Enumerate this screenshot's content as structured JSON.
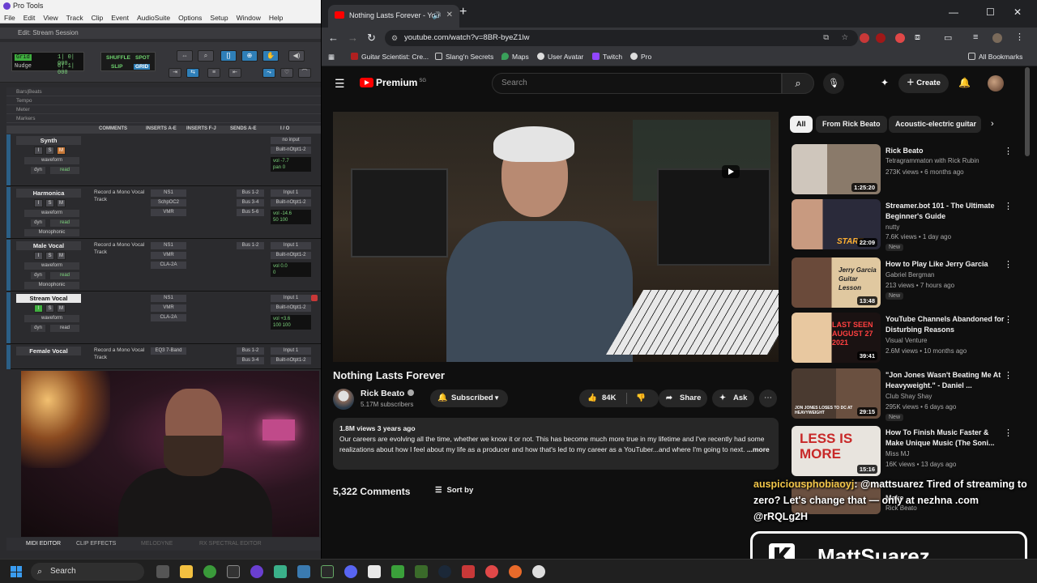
{
  "protools": {
    "app_title": "Pro Tools",
    "menu": [
      "File",
      "Edit",
      "View",
      "Track",
      "Clip",
      "Event",
      "AudioSuite",
      "Options",
      "Setup",
      "Window",
      "Help"
    ],
    "edit_window_title": "Edit: Stream Session",
    "grid_label": "Grid",
    "grid_value": "1| 0| 000",
    "nudge_label": "Nudge",
    "nudge_value": "0| 1| 000",
    "modes": [
      "SHUFFLE",
      "SPOT",
      "SLIP",
      "GRID"
    ],
    "rulers": [
      "Bars|Beats",
      "Tempo",
      "Meter",
      "Markers"
    ],
    "columns": [
      "COMMENTS",
      "INSERTS A-E",
      "INSERTS F-J",
      "SENDS A-E",
      "I / O"
    ],
    "tracks": [
      {
        "name": "Synth",
        "comment": "",
        "inserts": [],
        "sends": [],
        "io_in": "no input",
        "io_out": "Built-nOtpt1-2",
        "vol": "-7.7",
        "pan": "0",
        "dyn": "read",
        "mono": ""
      },
      {
        "name": "Harmonica",
        "comment": "Record a Mono Vocal Track",
        "inserts": [
          "NS1",
          "SchpOC2",
          "VMR"
        ],
        "sends": [
          "Bus 1-2",
          "Bus 3-4",
          "Bus 5-6"
        ],
        "io_in": "Input 1",
        "io_out": "Built-nOtpt1-2",
        "vol": "-14.6",
        "pan": "50  100",
        "dyn": "read",
        "mono": "Monophonic"
      },
      {
        "name": "Male Vocal",
        "comment": "Record a Mono Vocal Track",
        "inserts": [
          "NS1",
          "VMR",
          "CLA-2A"
        ],
        "sends": [
          "Bus 1-2"
        ],
        "io_in": "Input 1",
        "io_out": "Built-nOtpt1-2",
        "vol": "0.0",
        "pan": "0",
        "dyn": "read",
        "mono": "Monophonic"
      },
      {
        "name": "Stream Vocal",
        "comment": "",
        "inserts": [
          "NS1",
          "VMR",
          "CLA-2A"
        ],
        "sends": [],
        "io_in": "Input 1",
        "io_out": "Built-nOtpt1-2",
        "vol": "+3.6",
        "pan": "100  100",
        "dyn": "read",
        "mono": ""
      },
      {
        "name": "Female Vocal",
        "comment": "Record a Mono Vocal Track",
        "inserts": [
          "EQ3 7-Band"
        ],
        "sends": [
          "Bus 1-2",
          "Bus 3-4"
        ],
        "io_in": "Input 1",
        "io_out": "Built-nOtpt1-2",
        "vol": "",
        "pan": "",
        "dyn": "",
        "mono": ""
      }
    ],
    "bottom_tabs": [
      "MIDI EDITOR",
      "CLIP EFFECTS",
      "MELODYNE",
      "RX SPECTRAL EDITOR"
    ]
  },
  "browser": {
    "tab_title": "Nothing Lasts Forever - You",
    "url": "youtube.com/watch?v=8BR-byeZ1lw",
    "bookmarks": [
      "Guitar Scientist: Cre...",
      "Slang'n Secrets",
      "Maps",
      "User Avatar",
      "Twitch",
      "Pro"
    ],
    "all_bookmarks": "All Bookmarks"
  },
  "youtube": {
    "logo_text": "Premium",
    "logo_region": "SG",
    "search_placeholder": "Search",
    "create_label": "Create",
    "video_title": "Nothing Lasts Forever",
    "channel_name": "Rick Beato",
    "subscribers": "5.17M subscribers",
    "subscribed_label": "Subscribed",
    "likes": "84K",
    "share_label": "Share",
    "ask_label": "Ask",
    "desc_meta": "1.8M views  3 years ago",
    "desc_text": "Our careers are evolving all the time, whether we know it or not.  This has become much more true in my lifetime and I've recently had some realizations about how I feel about my life as a producer and how that's led to my career as a YouTuber...and where I'm going to next.",
    "desc_more": "...more",
    "comments_count": "5,322 Comments",
    "sort_label": "Sort by",
    "chips": [
      "All",
      "From Rick Beato",
      "Acoustic-electric guitar"
    ],
    "recommendations": [
      {
        "title": "Rick Beato",
        "channel": "Tetragrammaton with Rick Rubin",
        "views": "273K views • 6 months ago",
        "duration": "1:25:20",
        "new": "",
        "thumb_text": "",
        "thumb_color": "#7a6a5a"
      },
      {
        "title": "Streamer.bot 101 - The Ultimate Beginner's Guide",
        "channel": "nutty",
        "views": "7.6K views • 1 day ago",
        "duration": "22:09",
        "new": "New",
        "thumb_text": "START",
        "thumb_color": "#3a2a5a"
      },
      {
        "title": "How to Play Like Jerry Garcia",
        "channel": "Gabriel Bergman",
        "views": "213 views • 7 hours ago",
        "duration": "13:48",
        "new": "New",
        "thumb_text": "Jerry Garcia Guitar Lesson",
        "thumb_color": "#c8a070"
      },
      {
        "title": "YouTube Channels Abandoned for Disturbing Reasons",
        "channel": "Visual Venture",
        "views": "2.6M views • 10 months ago",
        "duration": "39:41",
        "new": "",
        "thumb_text": "LAST SEEN AUGUST 27 2021",
        "thumb_color": "#9a3a3a"
      },
      {
        "title": "\"Jon Jones Wasn't Beating Me At Heavyweight.\" - Daniel ...",
        "channel": "Club Shay Shay",
        "views": "295K views • 6 days ago",
        "duration": "29:15",
        "new": "New",
        "thumb_text": "JON JONES LOSES TO DC AT HEAVYWEIGHT",
        "thumb_color": "#4a3a30"
      },
      {
        "title": "How To Finish Music Faster & Make Unique Music (The Soni...",
        "channel": "Miss MJ",
        "views": "16K views • 13 days ago",
        "duration": "15:16",
        "new": "",
        "thumb_text": "LESS IS MORE",
        "thumb_color": "#e8e4de"
      },
      {
        "title": "Make",
        "channel": "Rick Beato",
        "views": "",
        "duration": "",
        "new": "",
        "thumb_text": "",
        "thumb_color": "#6a5040"
      }
    ]
  },
  "stream_overlay": {
    "chat_user": "auspiciousphobiaoyj",
    "chat_message": ": @mattsuarez Tired of streaming to zero? Let's change that — only at nezhna .com @rRQLg2H",
    "streamer_name": "MattSuarez"
  },
  "taskbar": {
    "search_label": "Search"
  }
}
